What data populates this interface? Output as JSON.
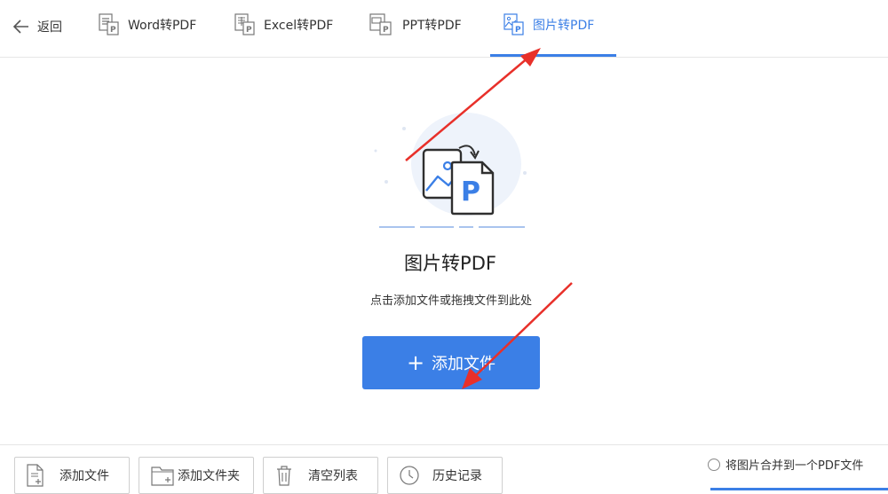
{
  "header": {
    "back_label": "返回",
    "tabs": [
      {
        "label": "Word转PDF",
        "icon": "word-to-pdf-icon",
        "active": false
      },
      {
        "label": "Excel转PDF",
        "icon": "excel-to-pdf-icon",
        "active": false
      },
      {
        "label": "PPT转PDF",
        "icon": "ppt-to-pdf-icon",
        "active": false
      },
      {
        "label": "图片转PDF",
        "icon": "image-to-pdf-icon",
        "active": true
      }
    ]
  },
  "main": {
    "title": "图片转PDF",
    "subtitle": "点击添加文件或拖拽文件到此处",
    "add_button_label": "添加文件"
  },
  "footer": {
    "buttons": [
      {
        "label": "添加文件",
        "icon": "add-file-icon"
      },
      {
        "label": "添加文件夹",
        "icon": "add-folder-icon"
      },
      {
        "label": "清空列表",
        "icon": "trash-icon"
      },
      {
        "label": "历史记录",
        "icon": "clock-icon"
      }
    ],
    "merge_option_label": "将图片合并到一个PDF文件",
    "merge_checked": false
  },
  "colors": {
    "accent": "#3b7fe6",
    "annotation": "#e8302a"
  }
}
